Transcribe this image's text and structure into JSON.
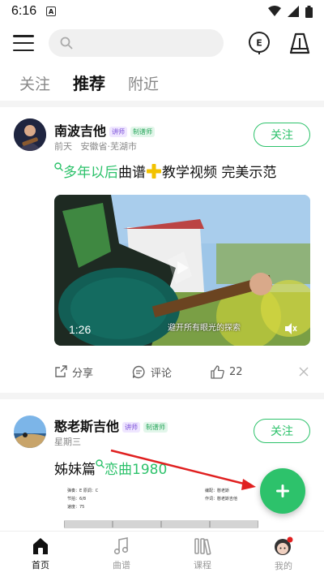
{
  "status": {
    "time": "6:16",
    "a_label": "A"
  },
  "tabs": [
    {
      "label": "关注",
      "active": false
    },
    {
      "label": "推荐",
      "active": true
    },
    {
      "label": "附近",
      "active": false
    }
  ],
  "posts": [
    {
      "author": "南波吉他",
      "badges": [
        "讲师",
        "制谱师"
      ],
      "meta_time": "前天",
      "meta_location": "安徽省·芜湖市",
      "follow_label": "关注",
      "title_green": "多年以后",
      "title_rest": "曲谱",
      "title_rest2": "教学视频  完美示范",
      "video_duration": "1:26",
      "video_caption": "避开所有眼光的探索",
      "actions": {
        "share": "分享",
        "comment": "评论",
        "likes": "22"
      }
    },
    {
      "author": "憨老斯吉他",
      "badges": [
        "讲师",
        "制谱师"
      ],
      "meta_time": "星期三",
      "follow_label": "关注",
      "title_black": "姊妹篇",
      "title_green": "恋曲1980",
      "sheet_left": [
        "弹奏：E  原调：C",
        "节拍：6/8",
        "速度：75"
      ],
      "sheet_right": [
        "编配：憨老斯",
        "作词：憨老斯吉他"
      ]
    }
  ],
  "nav": [
    {
      "label": "首页",
      "active": true
    },
    {
      "label": "曲谱",
      "active": false
    },
    {
      "label": "课程",
      "active": false
    },
    {
      "label": "我的",
      "active": false
    }
  ],
  "colors": {
    "accent": "#2dc26b",
    "lecturer_badge": "#7a4fd8"
  },
  "icons": [
    "menu-icon",
    "search-icon",
    "e-tuner-icon",
    "metronome-icon",
    "share-icon",
    "comment-icon",
    "like-icon",
    "close-icon",
    "mute-icon",
    "play-icon",
    "plus-icon",
    "home-icon",
    "music-note-icon",
    "books-icon",
    "profile-icon"
  ]
}
